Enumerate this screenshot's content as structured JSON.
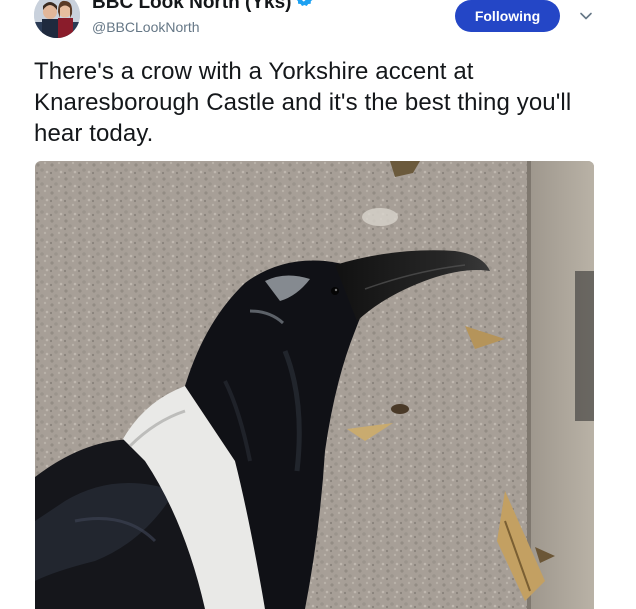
{
  "account": {
    "display_name": "BBC Look North (Yks)",
    "handle": "@BBCLookNorth"
  },
  "actions": {
    "follow_label": "Following"
  },
  "tweet": {
    "text": "There's a crow with a Yorkshire accent at Knaresborough Castle and it's the best thing you'll hear today."
  },
  "icons": {
    "verified": "verified-badge-icon",
    "menu": "chevron-down-icon"
  },
  "colors": {
    "follow_button": "#2446c6",
    "verified": "#1da1f2",
    "text": "#14171a",
    "handle": "#657786"
  }
}
